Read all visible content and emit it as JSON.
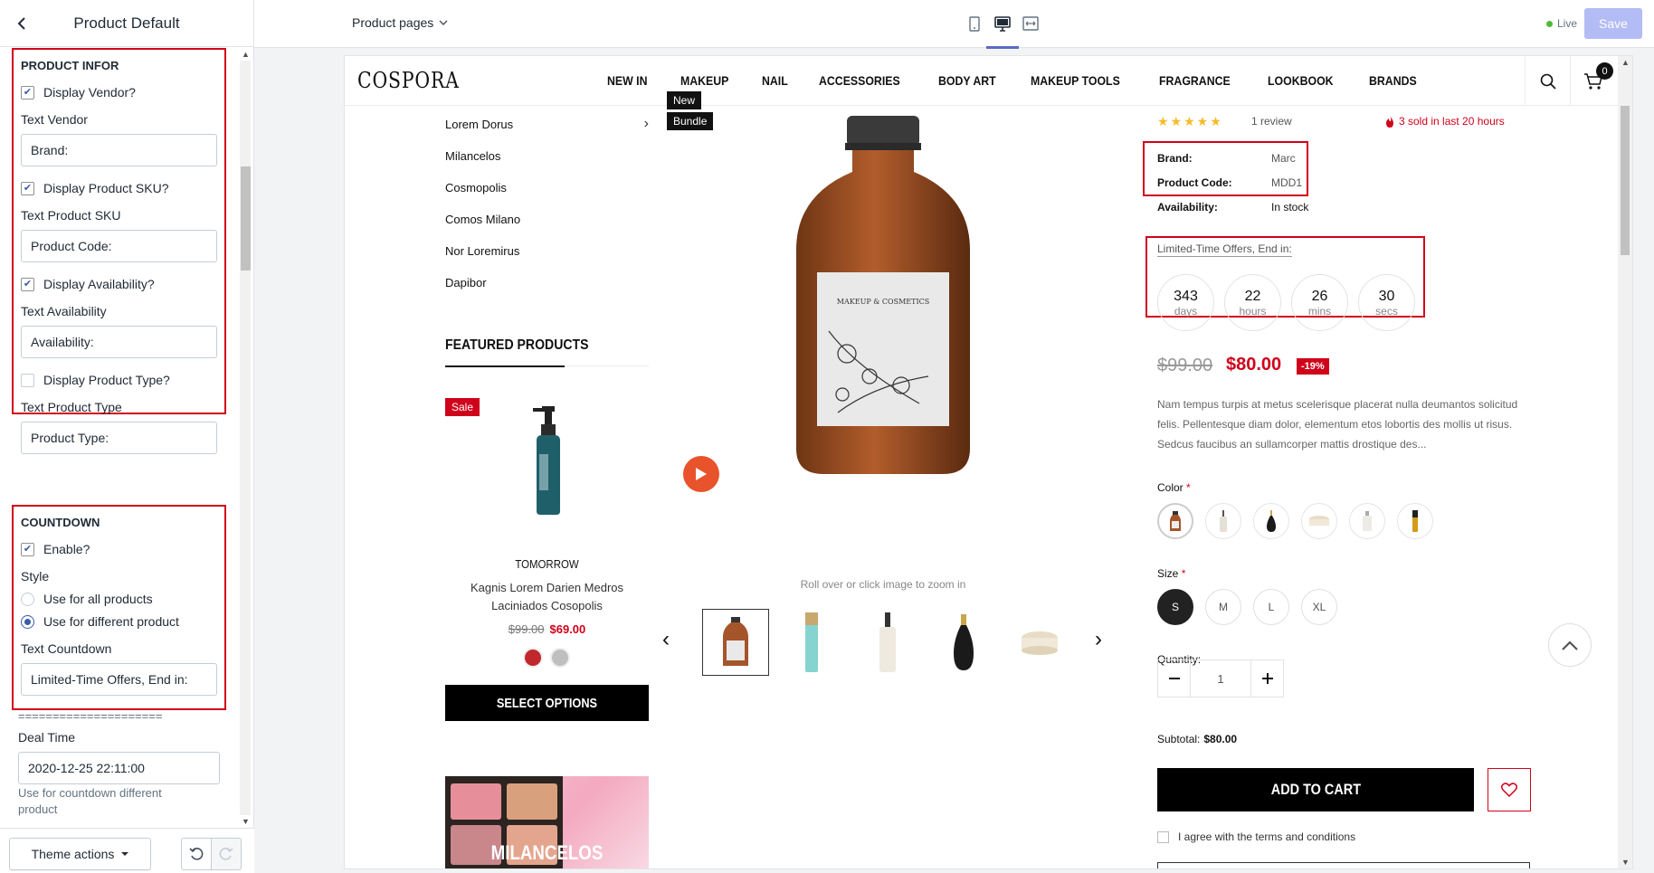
{
  "editor": {
    "title": "Product Default",
    "product_infor": {
      "heading": "PRODUCT INFOR",
      "display_vendor": "Display Vendor?",
      "text_vendor_label": "Text Vendor",
      "text_vendor_value": "Brand:",
      "display_sku": "Display Product SKU?",
      "text_sku_label": "Text Product SKU",
      "text_sku_value": "Product Code:",
      "display_availability": "Display Availability?",
      "text_availability_label": "Text Availability",
      "text_availability_value": "Availability:",
      "display_type": "Display Product Type?",
      "text_type_label": "Text Product Type",
      "text_type_value": "Product Type:"
    },
    "countdown": {
      "heading": "COUNTDOWN",
      "enable": "Enable?",
      "style_label": "Style",
      "style_all": "Use for all products",
      "style_different": "Use for different product",
      "text_label": "Text Countdown",
      "text_value": "Limited-Time Offers, End in:"
    },
    "divider": "=====================",
    "deal_time_label": "Deal Time",
    "deal_time_value": "2020-12-25 22:11:00",
    "help_text_1": "Use for countdown different",
    "help_text_2": "product",
    "footer": {
      "theme_actions": "Theme actions"
    }
  },
  "topbar": {
    "page_select": "Product pages",
    "live": "Live",
    "save": "Save"
  },
  "store": {
    "logo": "COSPORA",
    "menu": [
      "NEW IN",
      "MAKEUP",
      "NAIL",
      "ACCESSORIES",
      "BODY ART",
      "MAKEUP TOOLS",
      "FRAGRANCE",
      "LOOKBOOK",
      "BRANDS"
    ],
    "cart_count": "0",
    "categories": [
      "Lorem Dorus",
      "Milancelos",
      "Cosmopolis",
      "Comos Milano",
      "Nor Loremirus",
      "Dapibor"
    ],
    "featured": {
      "title": "FEATURED PRODUCTS",
      "sale": "Sale",
      "brand": "TOMORROW",
      "name_line1": "Kagnis Lorem Darien Medros",
      "name_line2": "Laciniados Cosopolis",
      "price_old": "$99.00",
      "price_new": "$69.00",
      "select_options": "SELECT OPTIONS",
      "promo": "MILANCELOS"
    },
    "gallery": {
      "tag_new": "New",
      "tag_bundle": "Bundle",
      "label_text": "MAKEUP & COSMETICS",
      "zoom_hint": "Roll over or click image to zoom in"
    },
    "product": {
      "review_count": "1 review",
      "sold": "3 sold in last 20 hours",
      "brand_key": "Brand:",
      "brand_val": "Marc",
      "code_key": "Product Code:",
      "code_val": "MDD1",
      "avail_key": "Availability:",
      "avail_val": "In stock",
      "countdown_label": "Limited-Time Offers, End in:",
      "countdown": [
        {
          "num": "343",
          "unit": "days"
        },
        {
          "num": "22",
          "unit": "hours"
        },
        {
          "num": "26",
          "unit": "mins"
        },
        {
          "num": "30",
          "unit": "secs"
        }
      ],
      "price_old": "$99.00",
      "price_new": "$80.00",
      "discount": "-19%",
      "description": "Nam tempus turpis at metus scelerisque placerat nulla deumantos solicitud felis. Pellentesque diam dolor, elementum etos lobortis des mollis ut risus. Sedcus faucibus an sullamcorper mattis drostique des...",
      "color_label": "Color",
      "size_label": "Size",
      "sizes": [
        "S",
        "M",
        "L",
        "XL"
      ],
      "quantity_label": "Quantity:",
      "quantity": "1",
      "subtotal_label": "Subtotal:",
      "subtotal_value": "$80.00",
      "add_to_cart": "ADD TO CART",
      "agree": "I agree with the terms and conditions",
      "required_mark": "*"
    }
  },
  "colors": {
    "highlight": "#d0021b",
    "accent": "#5c6ac4",
    "save_disabled": "#b3bcf5"
  }
}
